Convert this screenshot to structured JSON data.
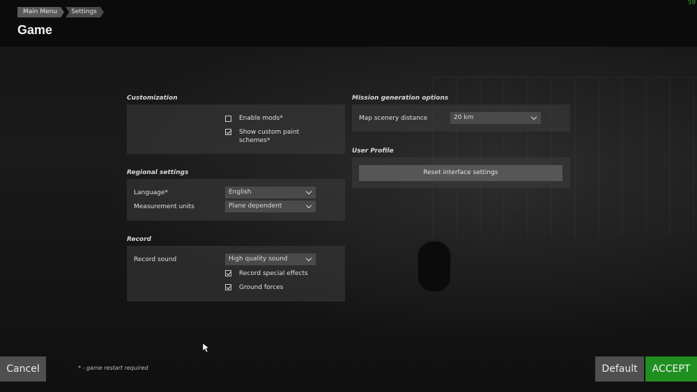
{
  "header": {
    "breadcrumb": [
      "Main Menu",
      "Settings"
    ],
    "title": "Game",
    "fps": "59"
  },
  "customization": {
    "title": "Customization",
    "enable_mods": {
      "label": "Enable mods*",
      "checked": false
    },
    "custom_paint": {
      "label_line1": "Show custom paint",
      "label_line2": "schemes*",
      "checked": true
    }
  },
  "regional": {
    "title": "Regional settings",
    "language_label": "Language*",
    "language_value": "English",
    "units_label": "Measurement units",
    "units_value": "Plane dependent"
  },
  "record": {
    "title": "Record",
    "sound_label": "Record sound",
    "sound_value": "High quality sound",
    "special_effects": {
      "label": "Record special effects",
      "checked": true
    },
    "ground_forces": {
      "label": "Ground forces",
      "checked": true
    }
  },
  "mission": {
    "title": "Mission generation options",
    "scenery_label": "Map scenery distance",
    "scenery_value": "20 km"
  },
  "profile": {
    "title": "User Profile",
    "reset_label": "Reset interface settings"
  },
  "footer": {
    "cancel": "Cancel",
    "footnote": "* - game restart required",
    "default": "Default",
    "accept": "ACCEPT"
  },
  "colors": {
    "accent": "#1f8f1f",
    "fps": "#3fae2e"
  }
}
